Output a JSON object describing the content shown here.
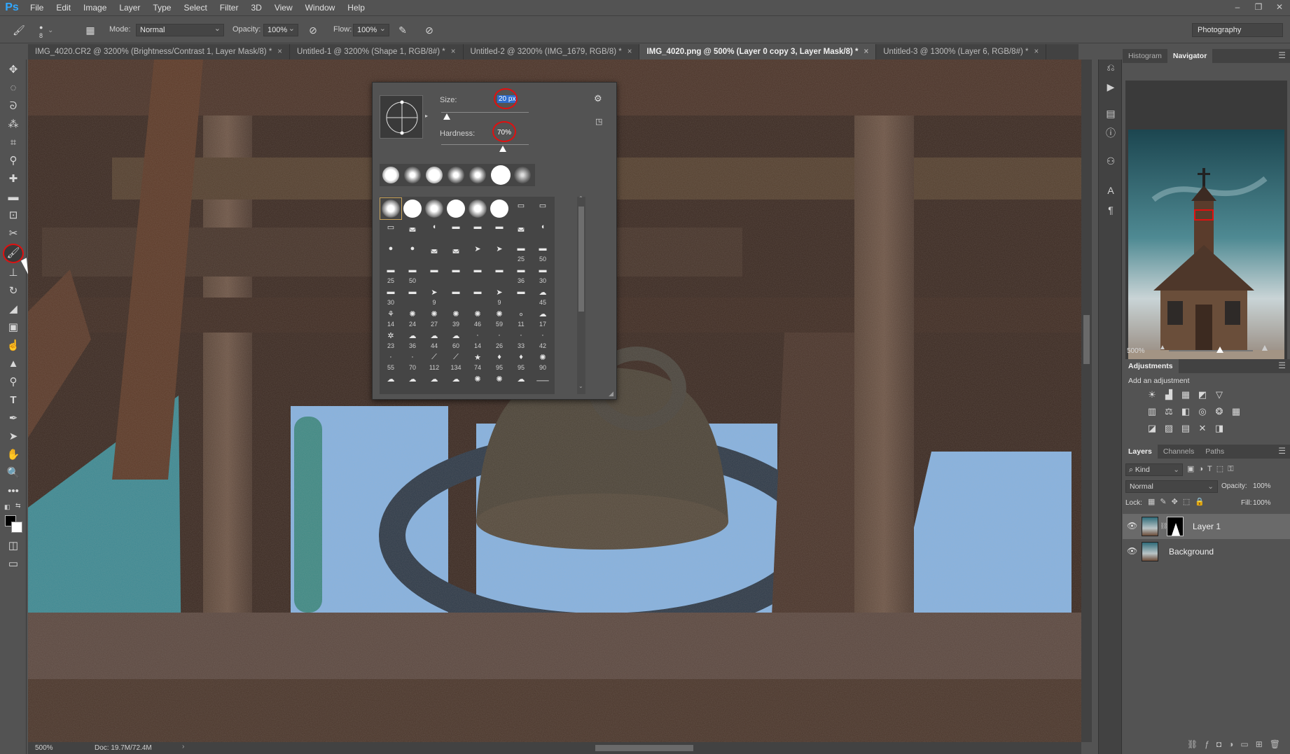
{
  "app": {
    "logo": "Ps"
  },
  "menu": [
    "File",
    "Edit",
    "Image",
    "Layer",
    "Type",
    "Select",
    "Filter",
    "3D",
    "View",
    "Window",
    "Help"
  ],
  "window_controls": [
    "–",
    "❐",
    "✕"
  ],
  "options": {
    "brush_size_small": "8",
    "mode_label": "Mode:",
    "mode_value": "Normal",
    "opacity_label": "Opacity:",
    "opacity_value": "100%",
    "flow_label": "Flow:",
    "flow_value": "100%",
    "workspace": "Photography"
  },
  "tabs": [
    {
      "label": "IMG_4020.CR2 @ 3200% (Brightness/Contrast 1, Layer Mask/8) *",
      "close": "×"
    },
    {
      "label": "Untitled-1 @ 3200% (Shape 1, RGB/8#) *",
      "close": "×"
    },
    {
      "label": "Untitled-2 @ 3200% (IMG_1679, RGB/8) *",
      "close": "×"
    },
    {
      "label": "IMG_4020.png @ 500% (Layer 0 copy 3, Layer Mask/8) *",
      "close": "×"
    },
    {
      "label": "Untitled-3 @ 1300% (Layer 6, RGB/8#) *",
      "close": "×"
    }
  ],
  "status": {
    "zoom": "500%",
    "doc": "Doc: 19.7M/72.4M"
  },
  "brush_picker": {
    "size_label": "Size:",
    "size_value": "20 px",
    "hardness_label": "Hardness:",
    "hardness_value": "70%",
    "size_fraction": 0.06,
    "hardness_fraction": 0.7,
    "preset_numbers": [
      [
        "",
        "",
        "",
        "",
        "",
        "",
        "",
        ""
      ],
      [
        "",
        "",
        "",
        "",
        "",
        "",
        "",
        ""
      ],
      [
        "",
        "",
        "",
        "",
        "",
        "",
        "25",
        "50"
      ],
      [
        "25",
        "50",
        "",
        "",
        "",
        "",
        "36",
        "30"
      ],
      [
        "30",
        "",
        "9",
        "",
        "",
        "9",
        "",
        "45"
      ],
      [
        "14",
        "24",
        "27",
        "39",
        "46",
        "59",
        "11",
        "17"
      ],
      [
        "23",
        "36",
        "44",
        "60",
        "14",
        "26",
        "33",
        "42"
      ],
      [
        "55",
        "70",
        "112",
        "134",
        "74",
        "95",
        "95",
        "90"
      ],
      [
        "",
        "",
        "",
        "",
        "",
        "",
        "",
        ""
      ]
    ]
  },
  "panels": {
    "top_tabs": [
      "Histogram",
      "Navigator"
    ],
    "navigator_zoom": "500%",
    "adjustments_title": "Adjustments",
    "adjustments_sub": "Add an adjustment",
    "layers_tabs": [
      "Layers",
      "Channels",
      "Paths"
    ],
    "kind_label": "Kind",
    "blend_mode": "Normal",
    "opacity_label": "Opacity:",
    "opacity_value": "100%",
    "lock_label": "Lock:",
    "fill_label": "Fill:",
    "fill_value": "100%",
    "layers": [
      {
        "name": "Layer 1",
        "selected": true
      },
      {
        "name": "Background",
        "selected": false
      }
    ]
  }
}
